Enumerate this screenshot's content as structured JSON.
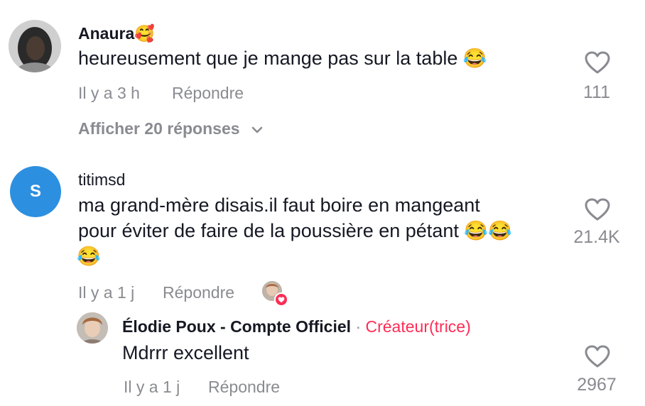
{
  "comments": [
    {
      "username": "Anaura🥰",
      "text": "heureusement que je mange pas sur la table 😂",
      "time": "Il y a 3 h",
      "reply_label": "Répondre",
      "likes": "111",
      "view_replies": "Afficher 20 réponses"
    },
    {
      "username": "titimsd",
      "avatar_letter": "S",
      "text_line1": "ma grand-mère disais.il faut boire en mangeant",
      "text_line2": "pour éviter de faire de la poussière en pétant 😂😂",
      "text_line3": "😂",
      "time": "Il y a 1 j",
      "reply_label": "Répondre",
      "likes": "21.4K",
      "reply": {
        "username": "Élodie Poux - Compte Officiel",
        "separator": "·",
        "badge": "Créateur(trice)",
        "text": "Mdrrr excellent",
        "time": "Il y a 1 j",
        "reply_label": "Répondre",
        "likes": "2967"
      }
    }
  ],
  "colors": {
    "creator_badge": "#fe2c55",
    "muted": "#8a8b91",
    "avatar_blue": "#2d8fe0"
  }
}
